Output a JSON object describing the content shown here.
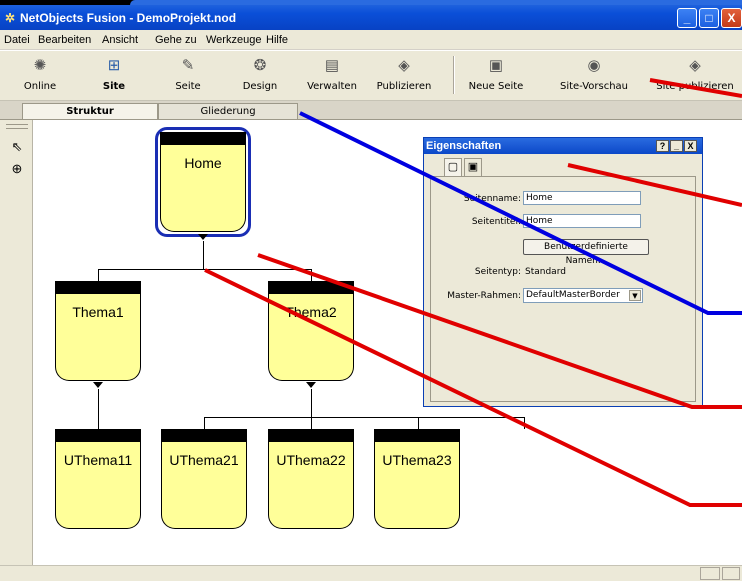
{
  "window": {
    "title": "NetObjects Fusion - DemoProjekt.nod",
    "buttons": {
      "minimize": "_",
      "maximize": "□",
      "close": "X"
    }
  },
  "menu": [
    "Datei",
    "Bearbeiten",
    "Ansicht",
    "Gehe zu",
    "Werkzeuge",
    "Hilfe"
  ],
  "toolbar": {
    "items": [
      {
        "label": "Online",
        "icon": "globe-icon"
      },
      {
        "label": "Site",
        "icon": "sitemap-icon",
        "active": true
      },
      {
        "label": "Seite",
        "icon": "page-edit-icon"
      },
      {
        "label": "Design",
        "icon": "palette-icon"
      },
      {
        "label": "Verwalten",
        "icon": "manage-icon"
      },
      {
        "label": "Publizieren",
        "icon": "publish-icon"
      },
      {
        "label": "Neue Seite",
        "icon": "new-page-icon"
      },
      {
        "label": "Site-Vorschau",
        "icon": "preview-icon"
      },
      {
        "label": "Site publizieren",
        "icon": "publish-site-icon"
      }
    ]
  },
  "tabs": [
    {
      "label": "Struktur",
      "active": true
    },
    {
      "label": "Gliederung",
      "active": false
    }
  ],
  "tree": {
    "root": "Home",
    "level1": [
      "Thema1",
      "Thema2"
    ],
    "level2": [
      "UThema11",
      "UThema21",
      "UThema22",
      "UThema23"
    ]
  },
  "properties": {
    "title": "Eigenschaften",
    "title_buttons": {
      "help": "?",
      "minimize": "_",
      "close": "X"
    },
    "seitenname_label": "Seitenname:",
    "seitenname_value": "Home",
    "seitentitel_label": "Seitentitel:",
    "seitentitel_value": "Home",
    "custom_names_button": "Benutzerdefinierte Namen...",
    "seitentyp_label": "Seitentyp:",
    "seitentyp_value": "Standard",
    "master_label": "Master-Rahmen:",
    "master_value": "DefaultMasterBorder"
  },
  "colors": {
    "node_fill": "#ffff99",
    "selection": "#1a2eb4",
    "annotation_red": "#e00000",
    "annotation_blue": "#0000e0"
  }
}
